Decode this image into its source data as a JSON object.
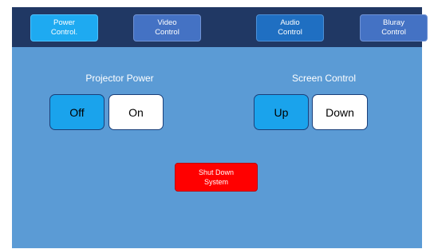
{
  "nav": {
    "power_label": "Power\nControl.",
    "video_label": "Video\nControl",
    "audio_label": "Audio\nControl",
    "bluray_label": "Bluray\nControl"
  },
  "projector": {
    "title": "Projector Power",
    "off_label": "Off",
    "on_label": "On",
    "selected": "Off"
  },
  "screen": {
    "title": "Screen Control",
    "up_label": "Up",
    "down_label": "Down",
    "selected": "Up"
  },
  "system": {
    "shutdown_label": "Shut Down\nSystem"
  },
  "colors": {
    "background": "#5b9bd5",
    "nav_bar": "#203864",
    "selected_button": "#1aa3ec",
    "unselected_button": "#ffffff",
    "shutdown_button": "#ff0000"
  }
}
